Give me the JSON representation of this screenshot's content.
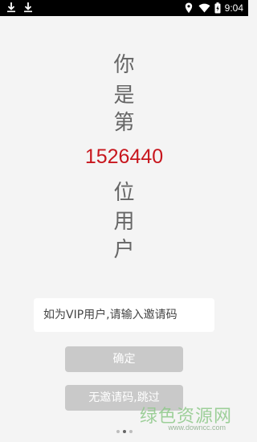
{
  "status_bar": {
    "time": "9:04",
    "icons": [
      "download-icon",
      "download-icon",
      "location-icon",
      "wifi-icon",
      "battery-charging-icon"
    ]
  },
  "headline": {
    "chars_before": [
      "你",
      "是",
      "第"
    ],
    "number": "1526440",
    "chars_after": [
      "位",
      "用",
      "户"
    ]
  },
  "invite": {
    "placeholder": "如为VIP用户,请输入邀请码",
    "value": ""
  },
  "buttons": {
    "confirm": "确定",
    "skip": "无邀请码,跳过"
  },
  "pager": {
    "count": 3,
    "active": 1
  },
  "watermark": {
    "text": "绿色资源网",
    "url": "www.downcc.com"
  },
  "colors": {
    "number": "#c8161d",
    "button_bg": "#c9c9c9",
    "background": "#f4f4f4"
  }
}
